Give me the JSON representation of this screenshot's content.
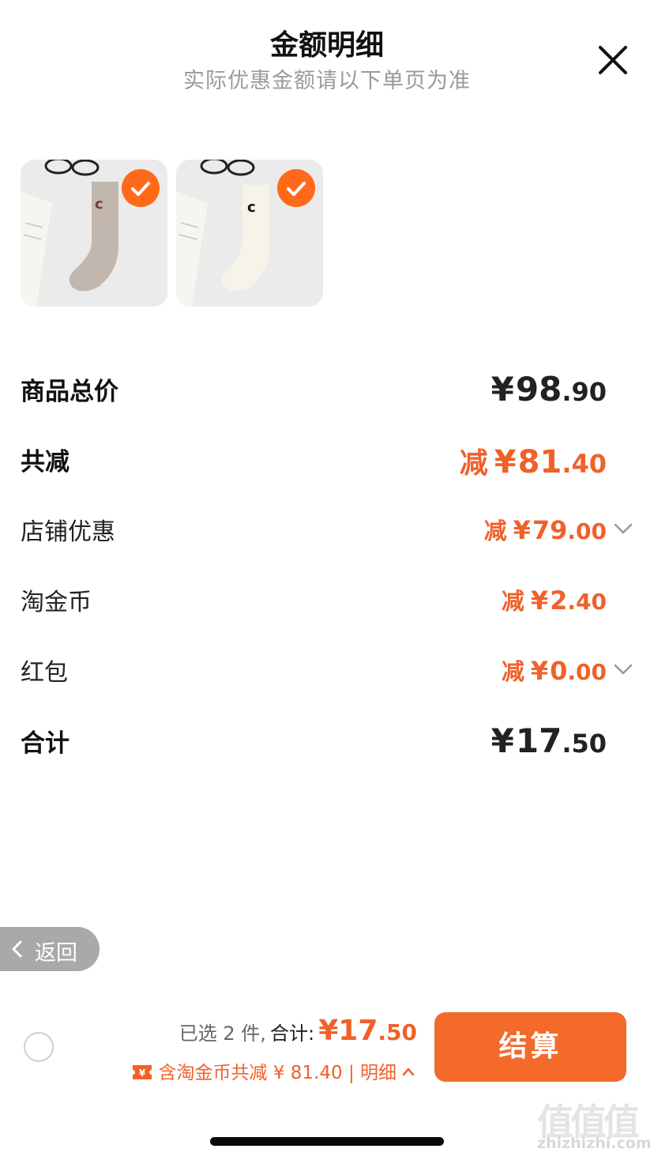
{
  "header": {
    "title": "金额明细",
    "subtitle": "实际优惠金额请以下单页为准"
  },
  "items": [
    {
      "name": "sock-beige",
      "selected": true
    },
    {
      "name": "sock-white",
      "selected": true
    }
  ],
  "breakdown": {
    "total_price": {
      "label": "商品总价",
      "yen": "¥",
      "int": "98",
      "dec": ".90"
    },
    "total_discount": {
      "label": "共减",
      "prefix": "减",
      "yen": "¥",
      "int": "81",
      "dec": ".40"
    },
    "shop_discount": {
      "label": "店铺优惠",
      "prefix": "减",
      "yen": "¥",
      "int": "79",
      "dec": ".00"
    },
    "gold_coin": {
      "label": "淘金币",
      "prefix": "减",
      "yen": "¥",
      "int": "2",
      "dec": ".40"
    },
    "red_packet": {
      "label": "红包",
      "prefix": "减",
      "yen": "¥",
      "int": "0",
      "dec": ".00"
    },
    "sum": {
      "label": "合计",
      "yen": "¥",
      "int": "17",
      "dec": ".50"
    }
  },
  "back_button": {
    "label": "返回"
  },
  "footer": {
    "selected_text": "已选 2 件,",
    "total_label": "合计:",
    "total_yen": "¥",
    "total_int": "17",
    "total_dec": ".50",
    "savings_text": "含淘金币共减 ¥ 81.40",
    "separator": "|",
    "detail_label": "明细",
    "checkout_label": "结算"
  },
  "watermark": {
    "glyphs": "值值值",
    "url": "zhizhizhi.com"
  },
  "colors": {
    "accent": "#f36a2a",
    "discount_text": "#f0612a",
    "back_button": "#a9a9a9"
  },
  "icons": [
    "close-icon",
    "check-icon",
    "chevron-down-icon",
    "chevron-left-icon",
    "coupon-icon",
    "chevron-up-icon",
    "radio-icon"
  ]
}
